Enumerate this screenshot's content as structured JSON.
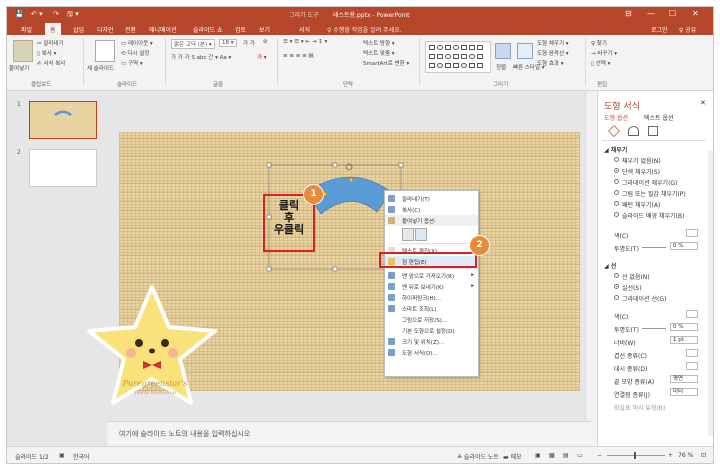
{
  "window": {
    "context_tab": "그리기 도구",
    "title": "테스트용.pptx - PowerPoint",
    "qa_save": "💾",
    "qa_undo": "↶ ▾",
    "qa_redo": "↷",
    "qa_extra": "🖫 ▾",
    "min": "⊟",
    "restore": "—",
    "max": "☐",
    "close": "✕"
  },
  "tabs": [
    "파일",
    "홈",
    "삽입",
    "디자인",
    "전환",
    "애니메이션",
    "슬라이드 쇼",
    "검토",
    "보기",
    "서식"
  ],
  "tell_me": "♀ 수행할 작업을 알려 주세요.",
  "login": "로그인",
  "share": "♀ 공유",
  "ribbon": {
    "clipboard": {
      "paste": "붙여넣기",
      "cut": "✂ 잘라내기",
      "copy": "▯ 복사 ▾",
      "format_copy": "✍ 서식 복사",
      "group": "클립보드"
    },
    "slides": {
      "new": "새 슬라이드",
      "layout": "▭ 레이아웃 ▾",
      "reset": "⟲ 다시 설정",
      "section": "▭ 구역 ▾",
      "group": "슬라이드"
    },
    "font": {
      "name": "맑은 고딕 (본) ▾",
      "size": "18 ▾",
      "grow": "가 가",
      "clear": "⊘",
      "styles": "가 가 가 S abc 간 ▾ Aa ▾",
      "color": "가 ▾",
      "group": "글꼴"
    },
    "paragraph": {
      "row1": "☰ ▾ ☰ ▾ ⇤ ⇥ ↕ ▾",
      "row2": "≡ ≡ ≡ ≡ ▤",
      "text_dir": "텍스트 방향 ▾",
      "align": "텍스트 맞춤 ▾",
      "smartart": "SmartArt로 변환 ▾",
      "group": "단락"
    },
    "drawing": {
      "arrange": "정렬",
      "quick": "빠른 스타일 ▾",
      "fill": "도형 채우기 ▾",
      "outline": "도형 윤곽선 ▾",
      "effect": "도형 효과 ▾",
      "group": "그리기"
    },
    "editing": {
      "find": "♀ 찾기",
      "replace": "→ 바꾸기 ▾",
      "select": "▯ 선택 ▾",
      "group": "편집"
    }
  },
  "thumbnails": [
    {
      "num": "1"
    },
    {
      "num": "2"
    }
  ],
  "slide": {
    "callout_text_1": "클릭",
    "callout_text_2": "후",
    "callout_text_3": "우클릭",
    "badge1": "1",
    "badge2": "2"
  },
  "context_menu": [
    {
      "label": "잘라내기(T)",
      "arrow": ""
    },
    {
      "label": "복사(C)",
      "arrow": ""
    },
    {
      "label": "붙여넣기 옵션:",
      "arrow": ""
    },
    {
      "label": "",
      "arrow": ""
    },
    {
      "label": "텍스트 편집(X)",
      "arrow": ""
    },
    {
      "label": "점 편집(E)",
      "arrow": ""
    },
    {
      "label": "맨 앞으로 가져오기(R)",
      "arrow": "▸"
    },
    {
      "label": "맨 뒤로 보내기(K)",
      "arrow": "▸"
    },
    {
      "label": "하이퍼링크(H)...",
      "arrow": ""
    },
    {
      "label": "스마트 조회(L)",
      "arrow": ""
    },
    {
      "label": "그림으로 저장(S)...",
      "arrow": ""
    },
    {
      "label": "기본 도형으로 설정(D)",
      "arrow": ""
    },
    {
      "label": "크기 및 위치(Z)...",
      "arrow": ""
    },
    {
      "label": "도형 서식(O)...",
      "arrow": ""
    }
  ],
  "notes": {
    "placeholder": "여기에 슬라이드 노트의 내용을 입력하십시오"
  },
  "pane": {
    "title": "도형 서식",
    "tab_shape": "도형 옵션",
    "tab_text": "텍스트 옵션",
    "fill_section": "채우기",
    "fill_options": [
      {
        "label": "채우기 없음(N)",
        "selected": false
      },
      {
        "label": "단색 채우기(S)",
        "selected": true
      },
      {
        "label": "그라데이션 채우기(G)",
        "selected": false
      },
      {
        "label": "그림 또는 질감 채우기(P)",
        "selected": false
      },
      {
        "label": "패턴 채우기(A)",
        "selected": false
      },
      {
        "label": "슬라이드 배경 채우기(B)",
        "selected": false
      }
    ],
    "color_label": "색(C)",
    "transparency_label": "투명도(T)",
    "transparency_value": "0 %",
    "line_section": "선",
    "line_options": [
      {
        "label": "선 없음(N)",
        "selected": false
      },
      {
        "label": "실선(S)",
        "selected": true
      },
      {
        "label": "그라데이션 선(G)",
        "selected": false
      }
    ],
    "line_color_label": "색(C)",
    "line_transparency_label": "투명도(T)",
    "line_transparency_value": "0 %",
    "width_label": "너비(W)",
    "width_value": "1 pt",
    "compound_label": "겹선 종류(C)",
    "dash_label": "대시 종류(D)",
    "cap_label": "끝 모양 종류(A)",
    "cap_value": "평면",
    "join_label": "연결점 종류(J)",
    "join_value": "미터",
    "begin_arrow_label": "화살표 머리 유형(B)"
  },
  "status": {
    "slide_count": "슬라이드 1/2",
    "language": "한국어",
    "notes_btn": "≙ 슬라이드 노트",
    "comments_btn": "▬ 메모",
    "zoom_value": "76 %",
    "fit": "⊡"
  },
  "sticker": {
    "line1": "Puregreenstar's",
    "line2": "World Workshop"
  },
  "colors": {
    "accent": "#b7472a",
    "shape_blue": "#5b9bd5",
    "callout_orange": "#e88c3b",
    "red_box": "#e02020"
  }
}
